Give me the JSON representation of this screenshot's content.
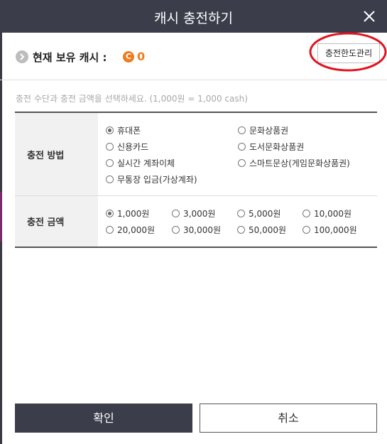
{
  "dialog": {
    "title": "캐시 충전하기",
    "close_icon": "close-icon"
  },
  "balance": {
    "label": "현재 보유 캐시 :",
    "coin_symbol": "C",
    "amount": "0",
    "accent_color": "#f07b1d"
  },
  "limit_button": {
    "label": "충전한도관리",
    "highlighted": true,
    "highlight_color": "#e0141e"
  },
  "hint": "충전 수단과 충전 금액을 선택하세요. (1,000원 = 1,000 cash)",
  "method": {
    "header": "충전 방법",
    "options": [
      {
        "label": "휴대폰",
        "selected": true
      },
      {
        "label": "문화상품권",
        "selected": false
      },
      {
        "label": "신용카드",
        "selected": false
      },
      {
        "label": "도서문화상품권",
        "selected": false
      },
      {
        "label": "실시간 계좌이체",
        "selected": false
      },
      {
        "label": "스마트문상(게임문화상품권)",
        "selected": false
      },
      {
        "label": "무통장 입금(가상계좌)",
        "selected": false
      }
    ]
  },
  "amount": {
    "header": "충전 금액",
    "options": [
      {
        "label": "1,000원",
        "selected": true
      },
      {
        "label": "3,000원",
        "selected": false
      },
      {
        "label": "5,000원",
        "selected": false
      },
      {
        "label": "10,000원",
        "selected": false
      },
      {
        "label": "20,000원",
        "selected": false
      },
      {
        "label": "30,000원",
        "selected": false
      },
      {
        "label": "50,000원",
        "selected": false
      },
      {
        "label": "100,000원",
        "selected": false
      }
    ]
  },
  "actions": {
    "confirm": "확인",
    "cancel": "취소"
  },
  "colors": {
    "titlebar": "#3b3d4a",
    "confirm_bg": "#3b3d4a"
  }
}
